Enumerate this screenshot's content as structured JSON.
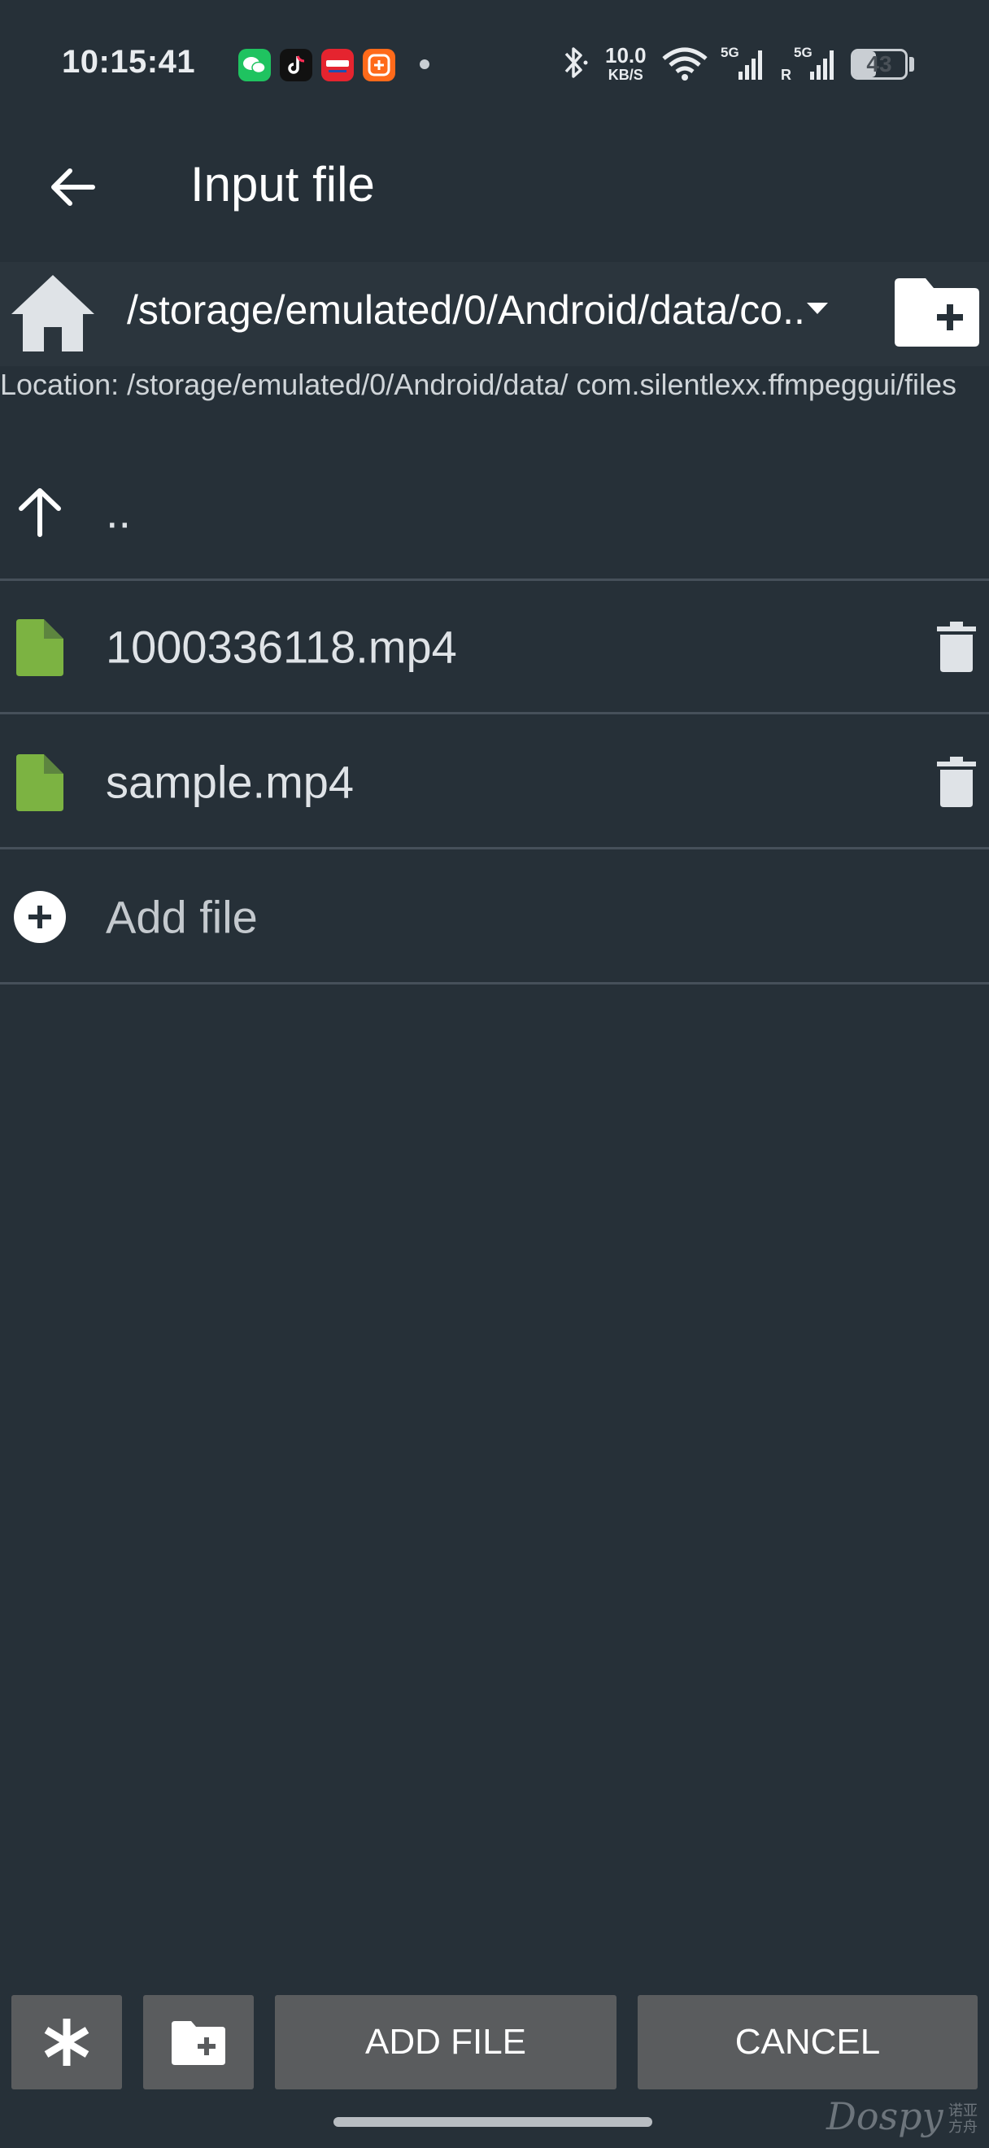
{
  "status_bar": {
    "time": "10:15:41",
    "network_speed": "10.0",
    "network_speed_unit": "KB/S",
    "signal_1_label": "5G",
    "signal_2_label": "5G",
    "signal_2_roaming": "R",
    "battery_level": "43",
    "notification_apps": [
      "wechat-icon",
      "tiktok-icon",
      "xiaohongshu-icon",
      "taobao-icon"
    ]
  },
  "app_bar": {
    "title": "Input file",
    "back_icon": "arrow-left-icon"
  },
  "path_bar": {
    "current_path": "/storage/emulated/0/Android/data/co..",
    "home_icon": "home-icon",
    "new_folder_icon": "folder-plus-icon"
  },
  "location": {
    "text": "Location: /storage/emulated/0/Android/data/ com.silentlexx.ffmpeggui/files"
  },
  "file_list": {
    "parent": {
      "label": "..",
      "icon": "arrow-up-icon"
    },
    "files": [
      {
        "name": "1000336118.mp4",
        "icon": "file-icon",
        "action_icon": "trash-icon"
      },
      {
        "name": "sample.mp4",
        "icon": "file-icon",
        "action_icon": "trash-icon"
      }
    ],
    "add_file": {
      "label": "Add file",
      "icon": "add-circle-icon"
    }
  },
  "bottom_bar": {
    "filter_icon": "asterisk-icon",
    "new_folder_icon": "folder-plus-icon",
    "add_file_label": "ADD FILE",
    "cancel_label": "CANCEL"
  },
  "watermark": {
    "text": "Dospy",
    "sub": "诺亚方舟"
  },
  "colors": {
    "background": "#263038",
    "file_icon": "#7cb342",
    "button": "#5a5c5e",
    "divider": "#46505a"
  }
}
